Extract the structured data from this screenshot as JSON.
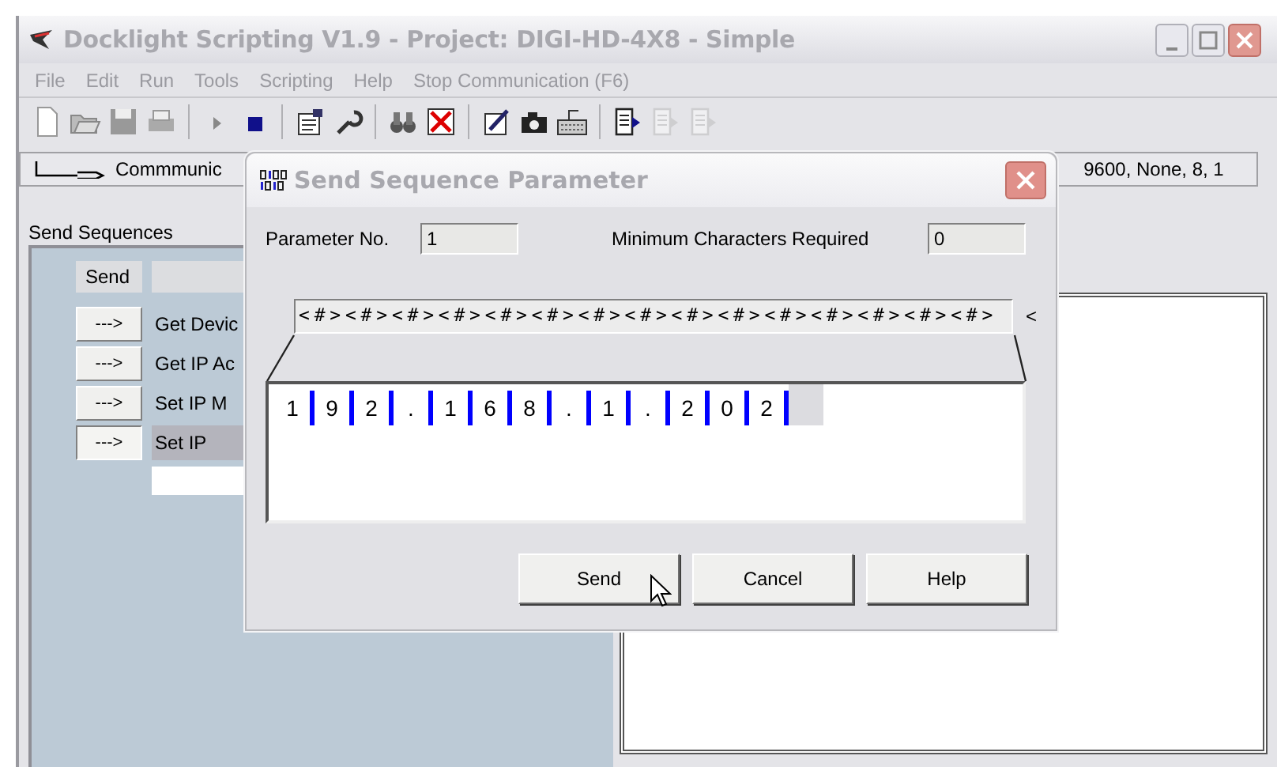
{
  "window": {
    "title": "Docklight Scripting V1.9 - Project: DIGI-HD-4X8 - Simple"
  },
  "menu": [
    "File",
    "Edit",
    "Run",
    "Tools",
    "Scripting",
    "Help",
    "Stop Communication  (F6)"
  ],
  "toolbar": [
    {
      "kind": "new",
      "disabled": false
    },
    {
      "kind": "open",
      "disabled": false
    },
    {
      "kind": "save",
      "disabled": false
    },
    {
      "kind": "print",
      "disabled": false
    },
    {
      "kind": "separator"
    },
    {
      "kind": "play",
      "disabled": false
    },
    {
      "kind": "stop",
      "disabled": false
    },
    {
      "kind": "separator"
    },
    {
      "kind": "properties",
      "disabled": false
    },
    {
      "kind": "key",
      "disabled": false
    },
    {
      "kind": "separator"
    },
    {
      "kind": "binoculars",
      "disabled": false
    },
    {
      "kind": "delete",
      "disabled": false
    },
    {
      "kind": "separator"
    },
    {
      "kind": "edit",
      "disabled": false
    },
    {
      "kind": "camera",
      "disabled": false
    },
    {
      "kind": "keyboard",
      "disabled": false
    },
    {
      "kind": "separator"
    },
    {
      "kind": "document",
      "disabled": false
    },
    {
      "kind": "document",
      "disabled": true
    },
    {
      "kind": "document",
      "disabled": true
    }
  ],
  "status_bar": {
    "connection": "Commmunic",
    "settings": "9600, None, 8, 1"
  },
  "send_sequences": {
    "title": "Send Sequences",
    "header": "Send",
    "rows": [
      {
        "button": "--->",
        "name": "Get Devic",
        "selected": false
      },
      {
        "button": "--->",
        "name": "Get IP Ac",
        "selected": false
      },
      {
        "button": "--->",
        "name": "Set IP M",
        "selected": false
      },
      {
        "button": "--->",
        "name": "Set IP",
        "selected": true
      }
    ]
  },
  "dialog": {
    "title": "Send Sequence Parameter",
    "parameter_label": "Parameter No.",
    "parameter_value": "1",
    "min_chars_label": "Minimum Characters Required",
    "min_chars_value": "0",
    "mask": "<#><#><#><#><#><#><#><#><#><#><#><#><#><#><#>",
    "mask_more": "<",
    "characters": [
      "1",
      "9",
      "2",
      ".",
      "1",
      "6",
      "8",
      ".",
      "1",
      ".",
      "2",
      "0",
      "2"
    ],
    "buttons": [
      "Send",
      "Cancel",
      "Help"
    ]
  }
}
